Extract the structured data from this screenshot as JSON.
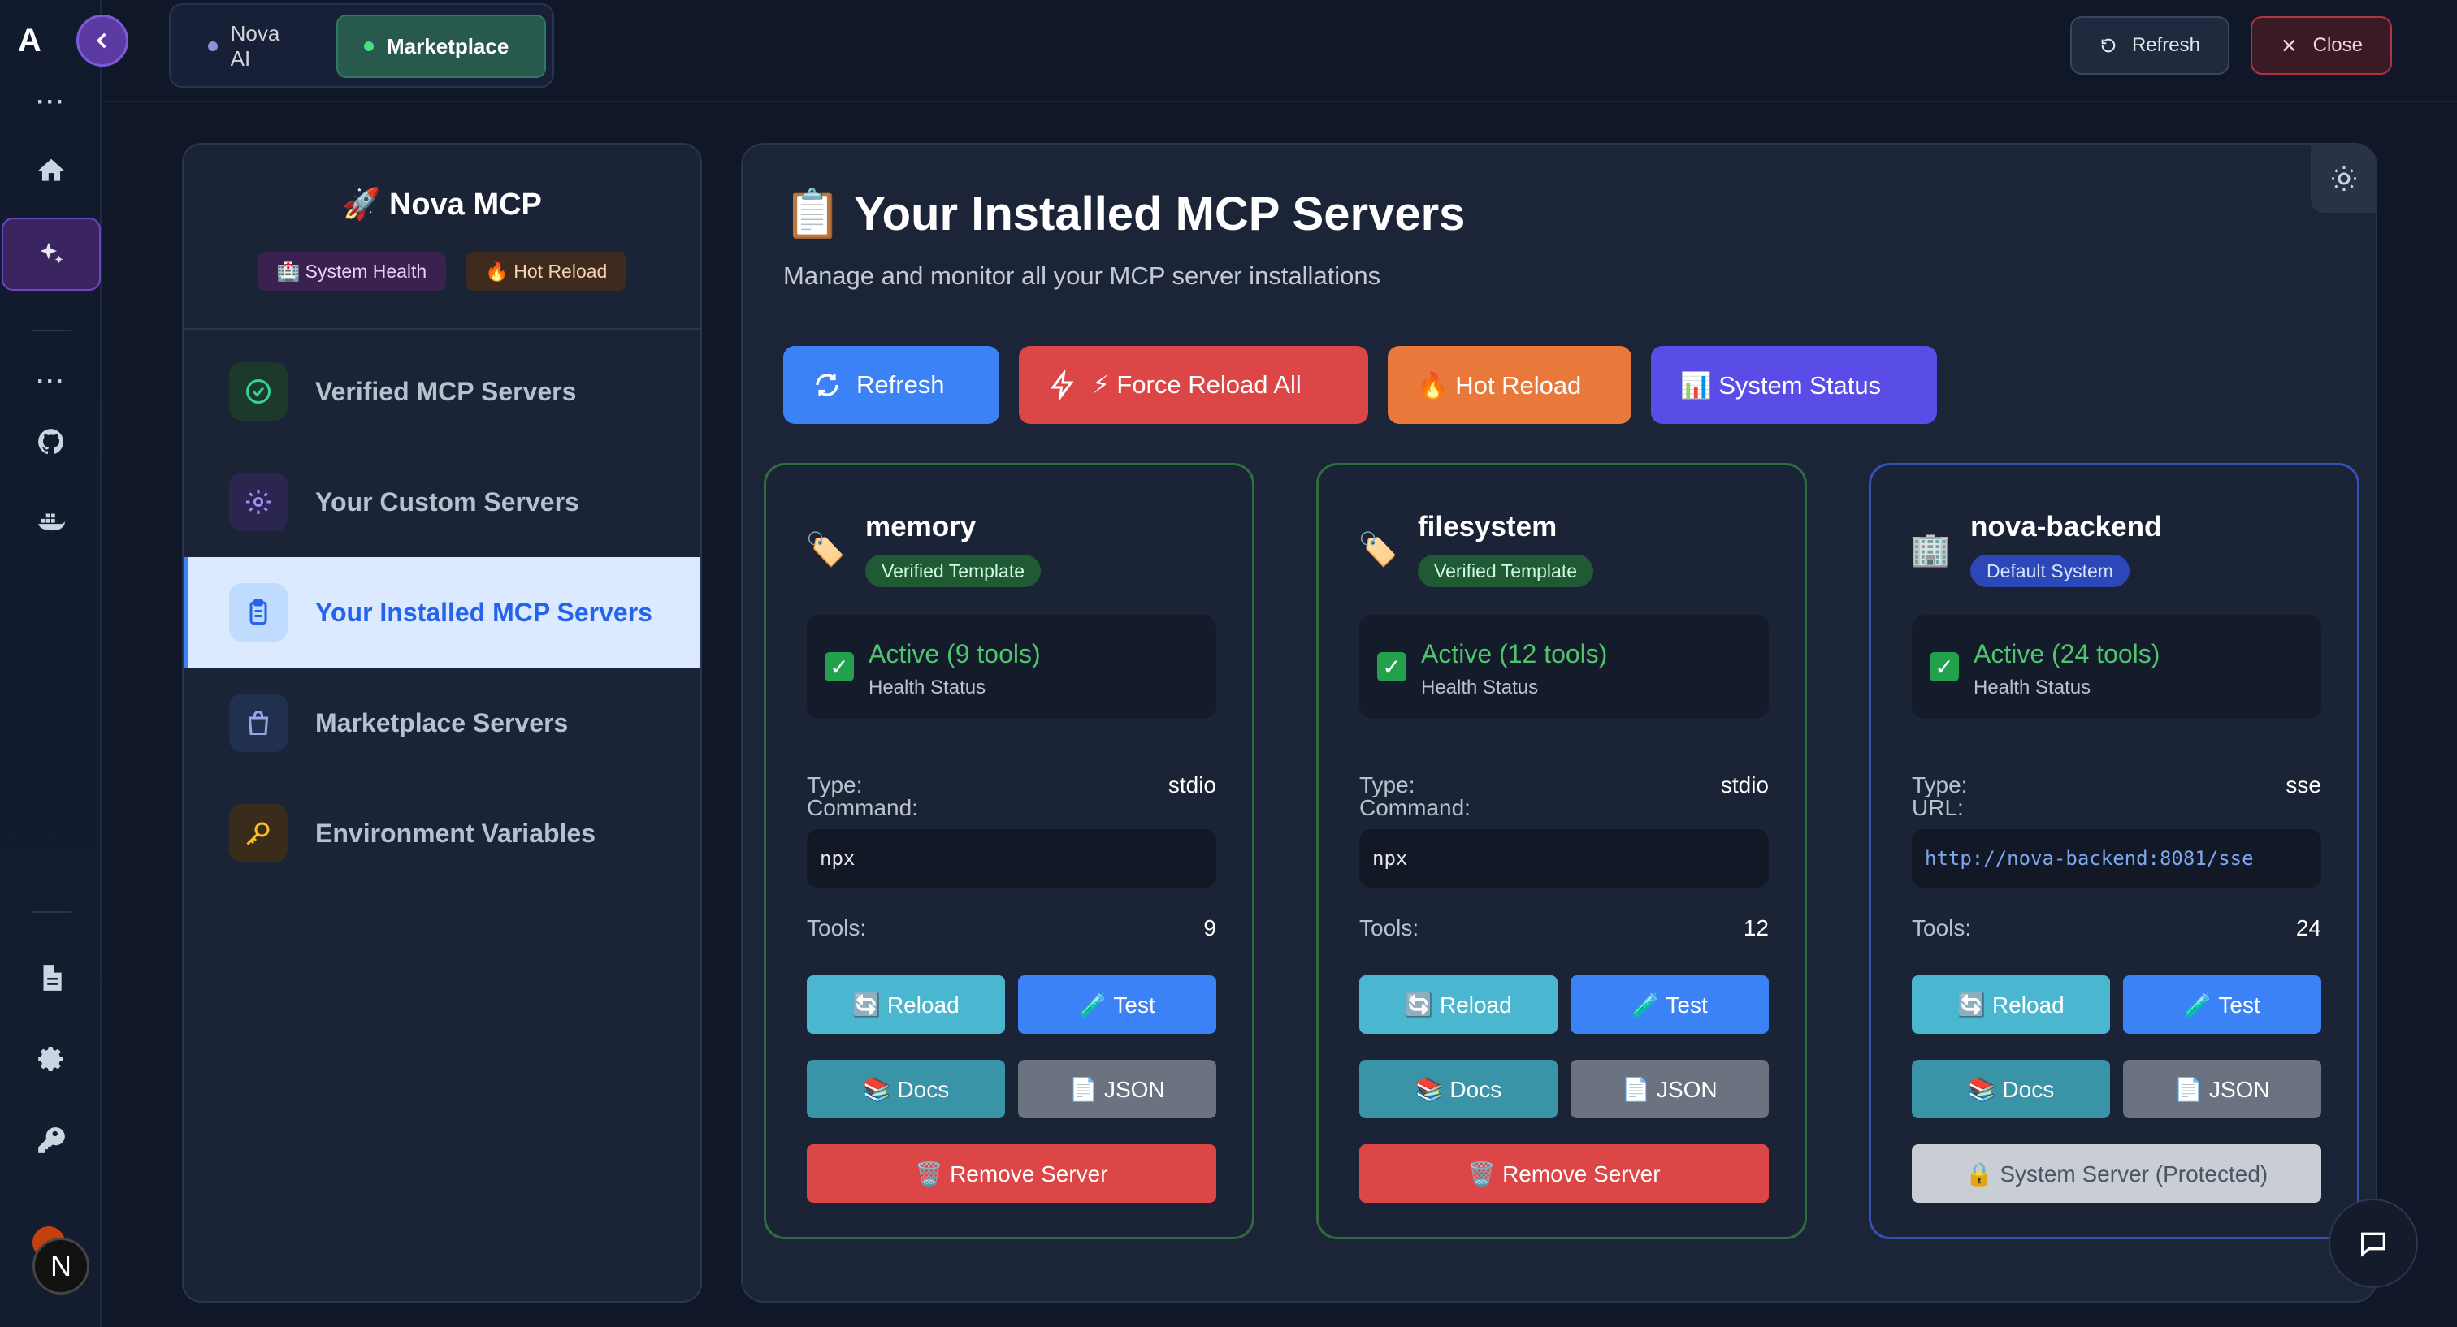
{
  "rail": {
    "logo": "A",
    "avatar": "N"
  },
  "topbar": {
    "tabs": [
      {
        "label": "Nova AI"
      },
      {
        "label": "Marketplace"
      }
    ],
    "refresh_label": "Refresh",
    "close_label": "Close"
  },
  "sidebar": {
    "title": "🚀 Nova MCP",
    "badges": [
      "🏥 System Health",
      "🔥 Hot Reload"
    ],
    "items": [
      {
        "label": "Verified MCP Servers",
        "icon": "check-circle-icon"
      },
      {
        "label": "Your Custom Servers",
        "icon": "gear-icon"
      },
      {
        "label": "Your Installed MCP Servers",
        "icon": "clipboard-icon",
        "active": true
      },
      {
        "label": "Marketplace Servers",
        "icon": "shopping-bag-icon"
      },
      {
        "label": "Environment Variables",
        "icon": "key-icon"
      }
    ]
  },
  "main": {
    "title": "📋 Your Installed MCP Servers",
    "subtitle": "Manage and monitor all your MCP server installations",
    "actions": {
      "refresh": "Refresh",
      "force_reload": "⚡ Force Reload All",
      "hot_reload": "🔥 Hot Reload",
      "system_status": "📊 System Status"
    },
    "cards": [
      {
        "icon": "🏷️",
        "name": "memory",
        "badge": "Verified Template",
        "status": "Active (9 tools)",
        "status_label": "Health Status",
        "type_label": "Type:",
        "type": "stdio",
        "cmd_label": "Command:",
        "cmd": "npx",
        "tools_label": "Tools:",
        "tools": "9",
        "reload": "🔄 Reload",
        "test": "🧪 Test",
        "docs": "📚 Docs",
        "json": "📄 JSON",
        "remove": "🗑️ Remove Server"
      },
      {
        "icon": "🏷️",
        "name": "filesystem",
        "badge": "Verified Template",
        "status": "Active (12 tools)",
        "status_label": "Health Status",
        "type_label": "Type:",
        "type": "stdio",
        "cmd_label": "Command:",
        "cmd": "npx",
        "tools_label": "Tools:",
        "tools": "12",
        "reload": "🔄 Reload",
        "test": "🧪 Test",
        "docs": "📚 Docs",
        "json": "📄 JSON",
        "remove": "🗑️ Remove Server"
      },
      {
        "icon": "🏢",
        "name": "nova-backend",
        "badge": "Default System",
        "status": "Active (24 tools)",
        "status_label": "Health Status",
        "type_label": "Type:",
        "type": "sse",
        "cmd_label": "URL:",
        "cmd": "http://nova-backend:8081/sse",
        "tools_label": "Tools:",
        "tools": "24",
        "reload": "🔄 Reload",
        "test": "🧪 Test",
        "docs": "📚 Docs",
        "json": "📄 JSON",
        "remove": "🔒 System Server (Protected)"
      }
    ]
  }
}
